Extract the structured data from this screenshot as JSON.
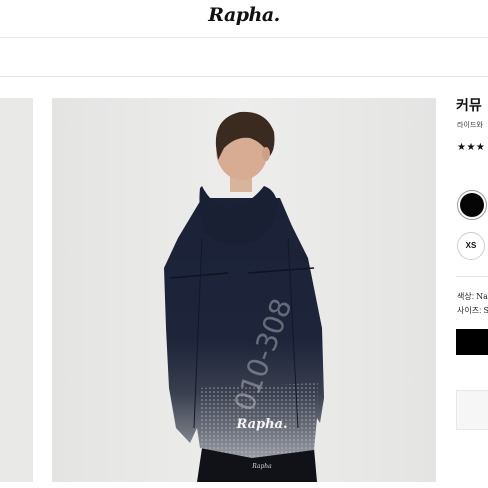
{
  "header": {
    "logo_text": "Rapha."
  },
  "product": {
    "title": "커뮤",
    "subtitle": "라이드와",
    "rating_stars": "★★★",
    "rating_value": 3,
    "swatch_color": "#050505",
    "size_label": "XS",
    "color_label": "색상: ",
    "color_value": "Nav",
    "size_field_label": "사이즈: ",
    "size_field_value": "S"
  },
  "image": {
    "watermark": "010-308",
    "jacket_logo": "Rapha.",
    "pants_logo": "Rapha"
  }
}
